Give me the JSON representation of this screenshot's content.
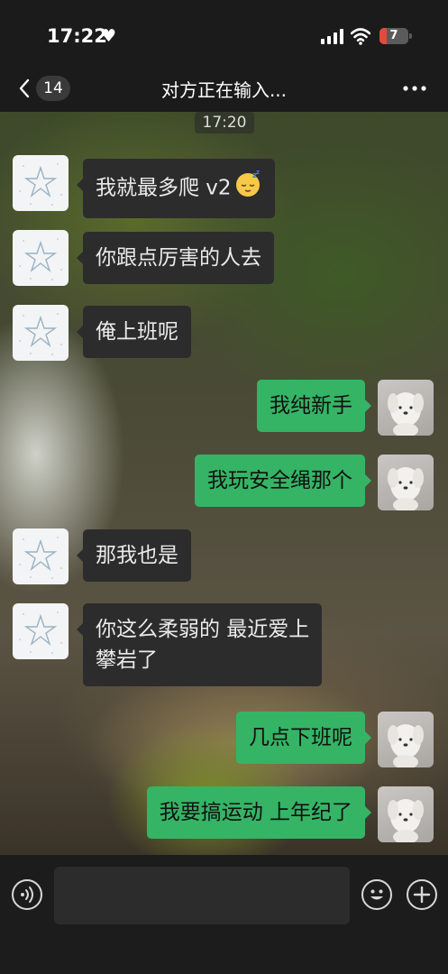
{
  "status_bar": {
    "time": "17:22",
    "heart_icon": "heart-icon",
    "battery_level": "7",
    "battery_color": "#e24a3c"
  },
  "nav": {
    "unread_count": "14",
    "title": "对方正在输入...",
    "back_icon": "chevron-left-icon",
    "more_icon": "more-dots-icon"
  },
  "chat": {
    "timestamp": "17:20",
    "messages": [
      {
        "from": "other",
        "text": "我就最多爬 v2"
      },
      {
        "from": "other",
        "text": "你跟点厉害的人去"
      },
      {
        "from": "other",
        "text": "俺上班呢"
      },
      {
        "from": "me",
        "text": "我纯新手"
      },
      {
        "from": "me",
        "text": "我玩安全绳那个"
      },
      {
        "from": "other",
        "text": "那我也是"
      },
      {
        "from": "other",
        "text_line1": "你这么柔弱的 最近爱上",
        "text_line2": "攀岩了"
      },
      {
        "from": "me",
        "text": "几点下班呢"
      },
      {
        "from": "me",
        "text": "我要搞运动 上年纪了"
      }
    ],
    "accent_color": "#35b465"
  },
  "input_bar": {
    "placeholder": "",
    "voice_icon": "voice-icon",
    "emoji_icon": "smiley-icon",
    "plus_icon": "plus-icon"
  }
}
